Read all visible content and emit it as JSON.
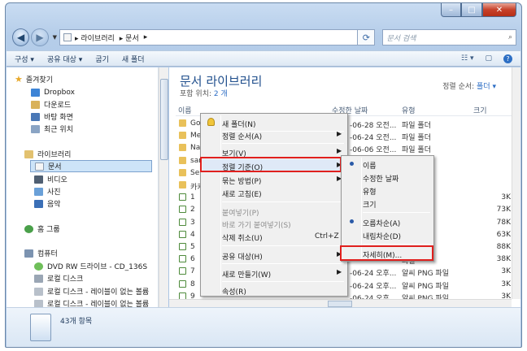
{
  "window": {
    "min": "–",
    "max": "□",
    "close": "✕"
  },
  "address": {
    "crumbs": [
      "▸ 라이브러리",
      "▸ 문서",
      "▸"
    ],
    "search_placeholder": "문서 검색"
  },
  "toolbar": {
    "organize": "구성 ▾",
    "share": "공유 대상 ▾",
    "burn": "굽기",
    "new_folder": "새 폴더",
    "view": "☷ ▾",
    "preview": "▢",
    "help": "?"
  },
  "nav": {
    "favorites_header": "즐겨찾기",
    "favorites": [
      "Dropbox",
      "다운로드",
      "바탕 화면",
      "최근 위치"
    ],
    "libraries_header": "라이브러리",
    "libraries": [
      "문서",
      "비디오",
      "사진",
      "음악"
    ],
    "homegroup": "홈 그룹",
    "computer_header": "컴퓨터",
    "computer": [
      "DVD RW 드라이브 - CD_136S",
      "로컬 디스크",
      "로컬 디스크 - 레이블이 없는 볼륨",
      "로컬 디스크 - 레이블이 없는 볼륨"
    ]
  },
  "library": {
    "title": "문서 라이브러리",
    "includes_label": "포함 위치:",
    "includes_count": "2 개",
    "arrange_label": "정렬 순서:",
    "arrange_value": "폴더 ▾"
  },
  "columns": [
    "이름",
    "수정한 날짜",
    "유형",
    "크기"
  ],
  "rows": [
    {
      "name": "Gom",
      "date": "-06-28 오전...",
      "type": "파일 폴더",
      "size": ""
    },
    {
      "name": "Mega",
      "date": "-06-24 오전...",
      "type": "파일 폴더",
      "size": ""
    },
    {
      "name": "Nativ",
      "date": "-06-06 오전...",
      "type": "파일 폴더",
      "size": ""
    },
    {
      "name": "sams",
      "date": "",
      "type": "",
      "size": ""
    },
    {
      "name": "Selfte",
      "date": "",
      "type": "",
      "size": ""
    },
    {
      "name": "카카",
      "date": "",
      "type": "",
      "size": ""
    },
    {
      "name": "1",
      "date": "",
      "type": "파일",
      "size": "3K"
    },
    {
      "name": "2",
      "date": "",
      "type": "파일",
      "size": "73K"
    },
    {
      "name": "3",
      "date": "",
      "type": "파일",
      "size": "78K"
    },
    {
      "name": "4",
      "date": "",
      "type": "파일",
      "size": "63K"
    },
    {
      "name": "5",
      "date": "",
      "type": "파일",
      "size": "88K"
    },
    {
      "name": "6",
      "date": "",
      "type": "파일",
      "size": "38K"
    },
    {
      "name": "7",
      "date": "-06-24 오후...",
      "type": "알씨 PNG 파일",
      "size": "3K"
    },
    {
      "name": "8",
      "date": "-06-24 오후...",
      "type": "알씨 PNG 파일",
      "size": "3K"
    },
    {
      "name": "9",
      "date": "-06-24 오후...",
      "type": "알씨 PNG 파일",
      "size": "3K"
    }
  ],
  "context_menu": {
    "new_folder": "새 폴더(N)",
    "arrange_by": "정렬 순서(A)",
    "view": "보기(V)",
    "sort_by": "정렬 기준(O)",
    "group_by": "묶는 방법(P)",
    "refresh": "새로 고침(E)",
    "paste": "붙여넣기(P)",
    "paste_shortcut": "바로 가기 붙여넣기(S)",
    "undo_delete": "삭제 취소(U)",
    "undo_shortcut": "Ctrl+Z",
    "share_with": "공유 대상(H)",
    "new": "새로 만들기(W)",
    "properties": "속성(R)"
  },
  "sort_submenu": {
    "name": "이름",
    "date_modified": "수정한 날짜",
    "type": "유형",
    "size": "크기",
    "ascending": "오름차순(A)",
    "descending": "내림차순(D)",
    "more": "자세히(M)..."
  },
  "status": {
    "item_count": "43개 항목"
  },
  "colors": {
    "highlight": "#e0201e",
    "accent": "#2b6cc4"
  }
}
